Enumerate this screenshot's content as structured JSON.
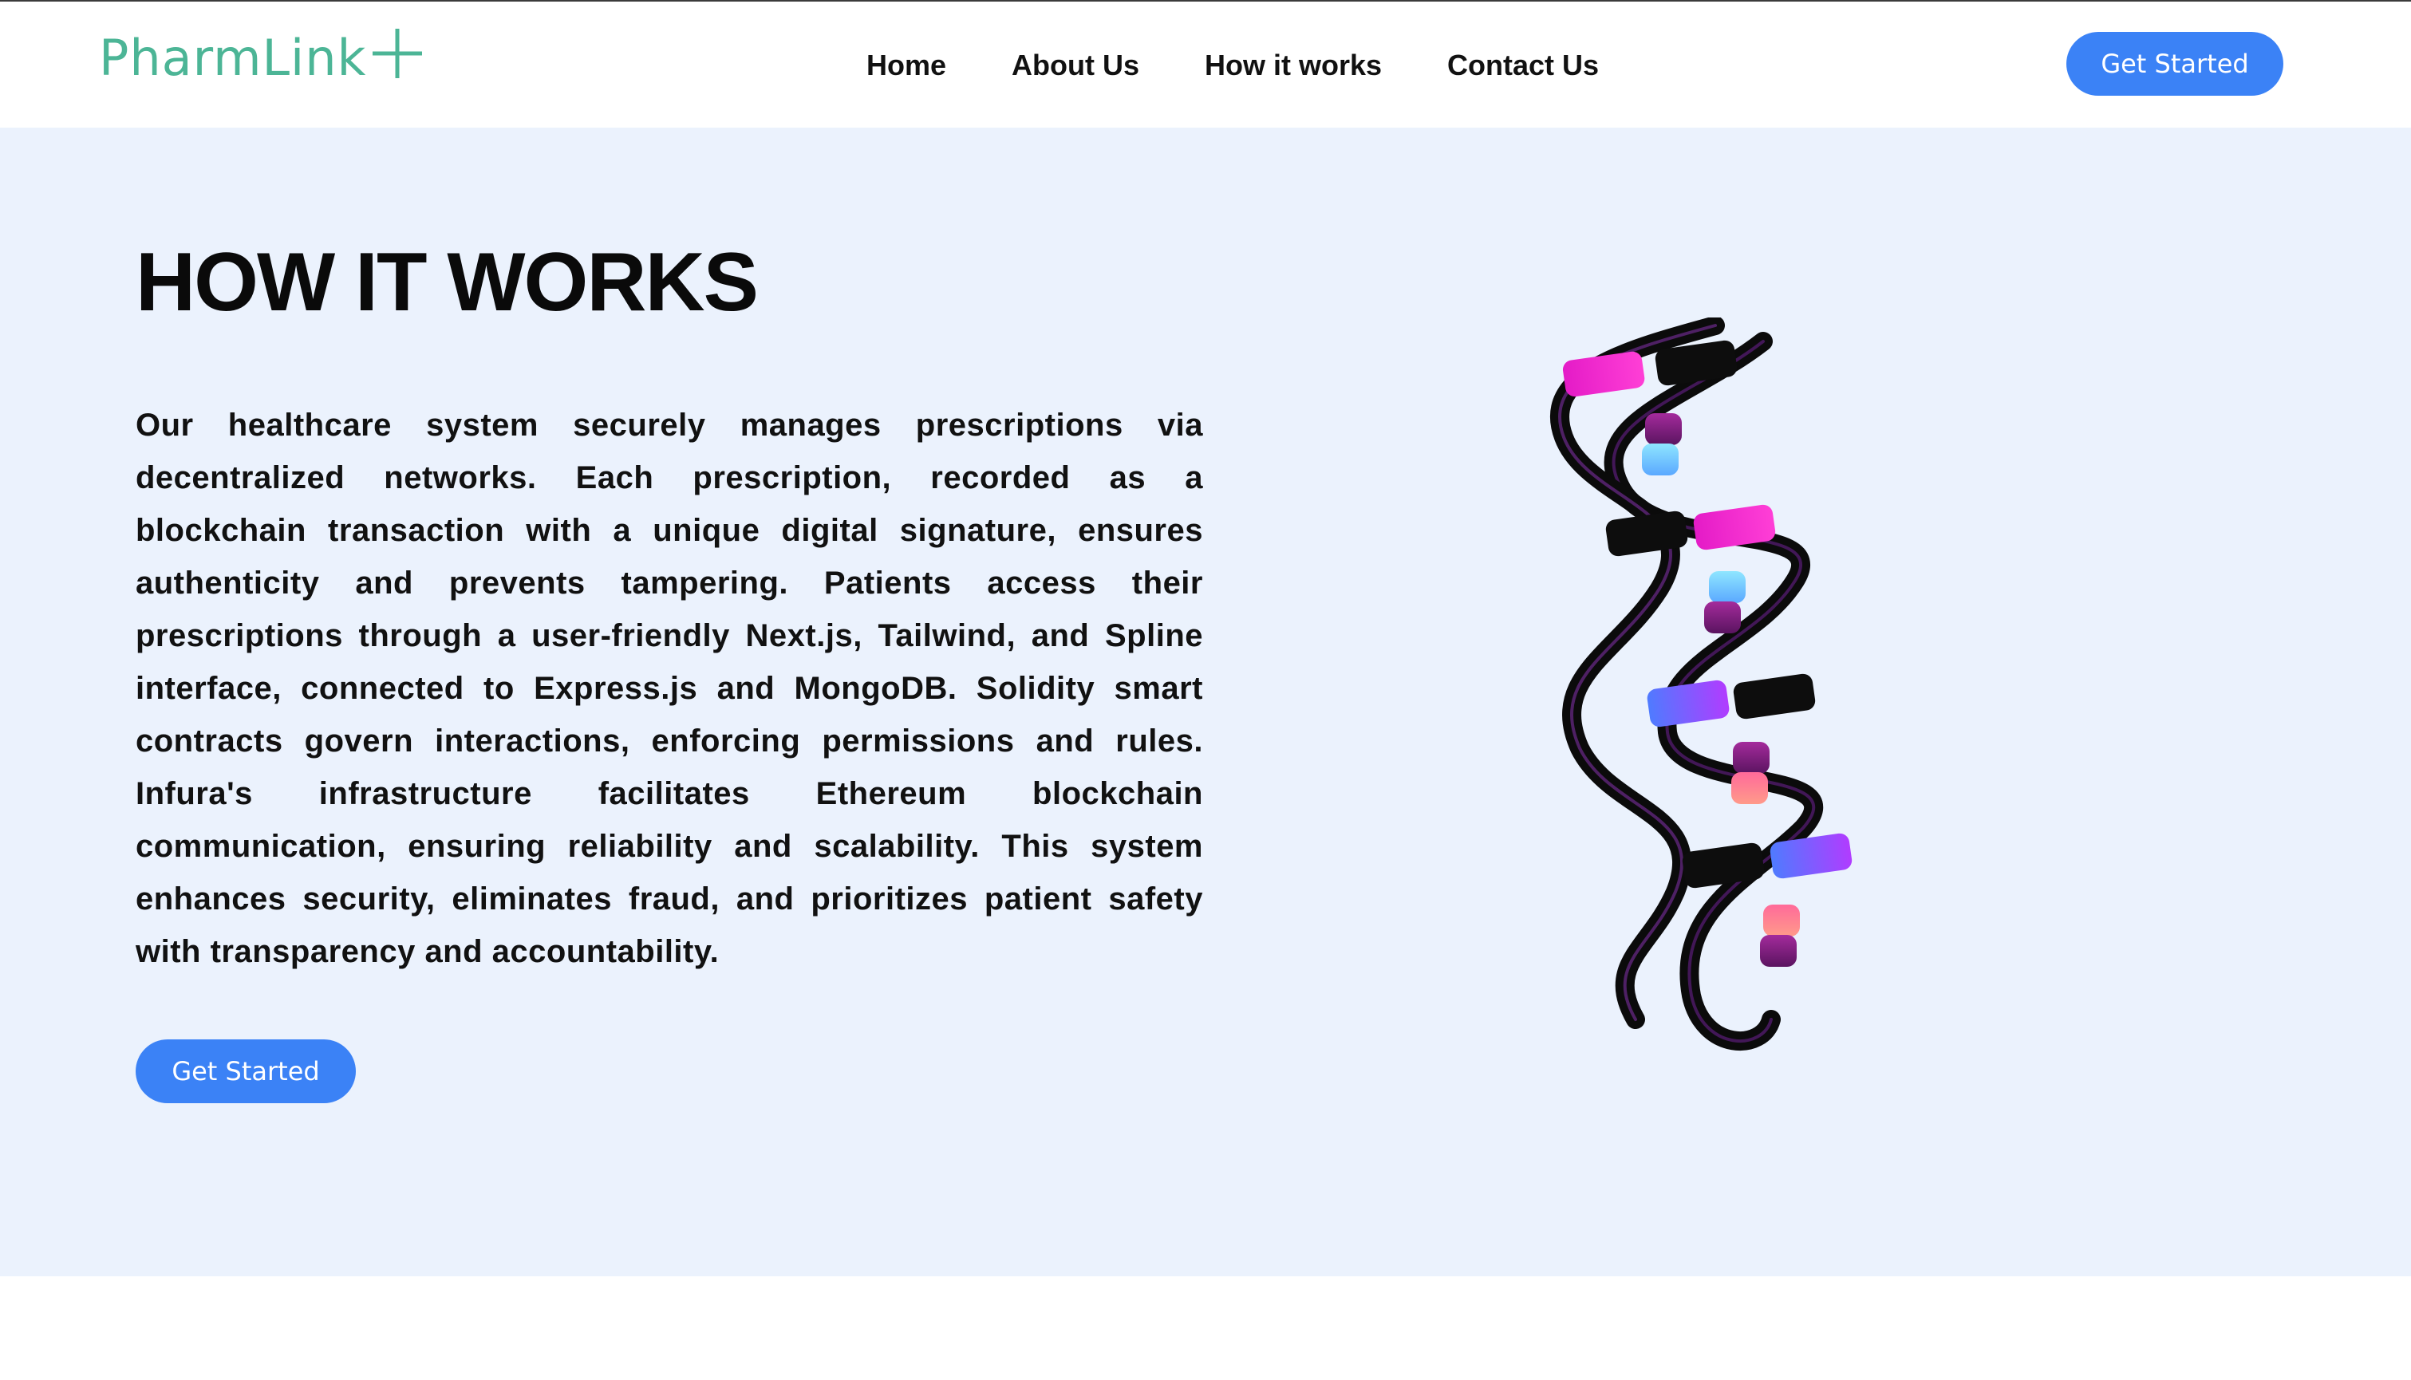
{
  "brand": {
    "name": "PharmLink",
    "accent": "#4cb596"
  },
  "nav": {
    "links": [
      {
        "label": "Home"
      },
      {
        "label": "About Us"
      },
      {
        "label": "How it works"
      },
      {
        "label": "Contact Us"
      }
    ],
    "cta_label": "Get Started"
  },
  "hero": {
    "title": "HOW IT WORKS",
    "description": "Our healthcare system securely manages prescriptions via decentralized networks. Each prescription, recorded as a blockchain transaction with a unique digital signature, ensures authenticity and prevents tampering. Patients access their prescriptions through a user-friendly Next.js, Tailwind, and Spline interface, connected to Express.js and MongoDB. Solidity smart contracts govern interactions, enforcing permissions and rules. Infura's infrastructure facilitates Ethereum blockchain communication, ensuring reliability and scalability. This system enhances security, eliminates fraud, and prioritizes patient safety with transparency and accountability.",
    "cta_label": "Get Started",
    "illustration": "dna-helix-3d"
  },
  "colors": {
    "primary_button": "#3b82f6",
    "hero_background": "#ebf2fd",
    "text": "#111111"
  }
}
